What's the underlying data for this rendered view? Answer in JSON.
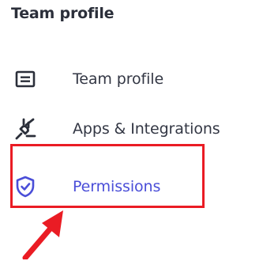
{
  "header": {
    "title": "Team profile"
  },
  "nav": {
    "items": [
      {
        "label": "Team profile",
        "icon": "list-card-icon"
      },
      {
        "label": "Apps & Integrations",
        "icon": "plug-icon"
      },
      {
        "label": "Permissions",
        "icon": "shield-check-icon",
        "active": true
      }
    ]
  },
  "annotation": {
    "highlight_color": "#ea1c24",
    "arrow_color": "#ea1c24"
  },
  "colors": {
    "active_text": "#4a4ed8",
    "text": "#333744",
    "title": "#2b2f3a"
  }
}
